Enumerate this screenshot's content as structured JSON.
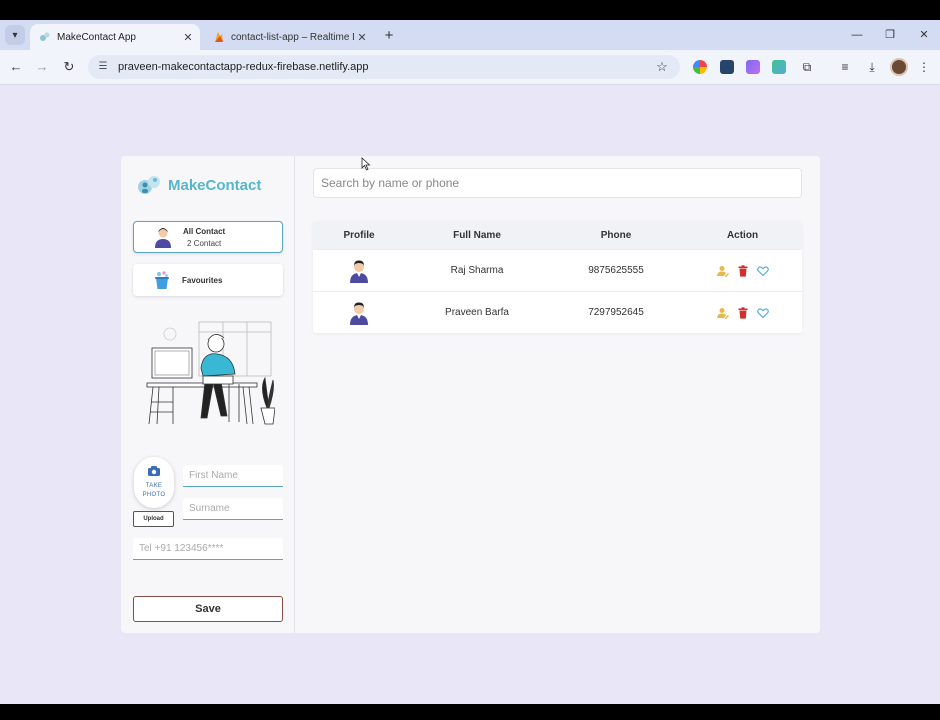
{
  "browser": {
    "tabs": [
      {
        "title": "MakeContact App",
        "active": true
      },
      {
        "title": "contact-list-app – Realtime Dat",
        "active": false
      }
    ],
    "url": "praveen-makecontactapp-redux-firebase.netlify.app",
    "window_controls": [
      "—",
      "❐",
      "✕"
    ]
  },
  "app": {
    "brand": "MakeContact",
    "nav": [
      {
        "label": "All Contact",
        "sub": "2 Contact",
        "active": true
      },
      {
        "label": "Favourites",
        "sub": "",
        "active": false
      }
    ],
    "form": {
      "take_photo_line1": "TAKE",
      "take_photo_line2": "PHOTO",
      "upload_label": "Upload",
      "first_name_placeholder": "First Name",
      "surname_placeholder": "Surname",
      "phone_placeholder": "Tel +91 123456****",
      "save_label": "Save"
    },
    "search_placeholder": "Search by name or phone",
    "table": {
      "headers": [
        "Profile",
        "Full Name",
        "Phone",
        "Action"
      ],
      "rows": [
        {
          "name": "Raj Sharma",
          "phone": "9875625555"
        },
        {
          "name": "Praveen Barfa",
          "phone": "7297952645"
        }
      ]
    },
    "colors": {
      "brand": "#56b6cc",
      "edit": "#e8b84a",
      "delete": "#d32f2f",
      "favourite": "#4aa8e0",
      "page_bg": "#e9e6f7"
    }
  }
}
